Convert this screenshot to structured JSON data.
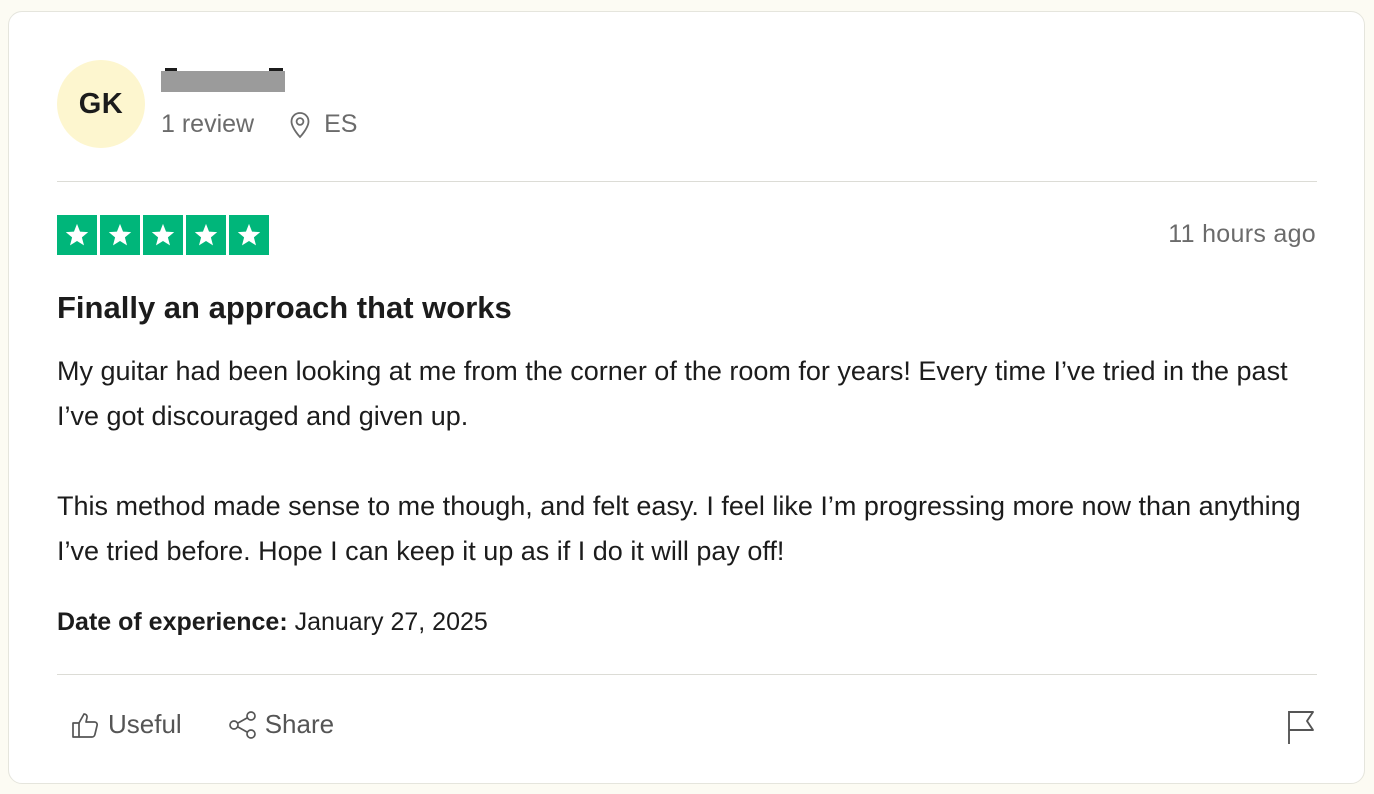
{
  "reviewer": {
    "initials": "GK",
    "avatar_color": "#fdf6cf",
    "review_count": "1 review",
    "location_icon": "location-pin-icon",
    "country": "ES"
  },
  "rating": {
    "stars": 5,
    "max": 5,
    "star_color": "#00b67a",
    "icon": "star-icon"
  },
  "timestamp": "11 hours ago",
  "review": {
    "title": "Finally an approach that works",
    "paragraphs": [
      "My guitar had been looking at me from the corner of the room for years! Every time I’ve tried in the past I’ve got discouraged and given up.",
      "This method made sense to me though, and felt easy. I feel like I’m progressing more now than anything I’ve tried before. Hope I can keep it up as if I do it will pay off!"
    ],
    "experience_label": "Date of experience:",
    "experience_date": "January 27, 2025"
  },
  "actions": {
    "useful_label": "Useful",
    "useful_icon": "thumbs-up-icon",
    "share_label": "Share",
    "share_icon": "share-icon",
    "flag_icon": "flag-icon"
  }
}
